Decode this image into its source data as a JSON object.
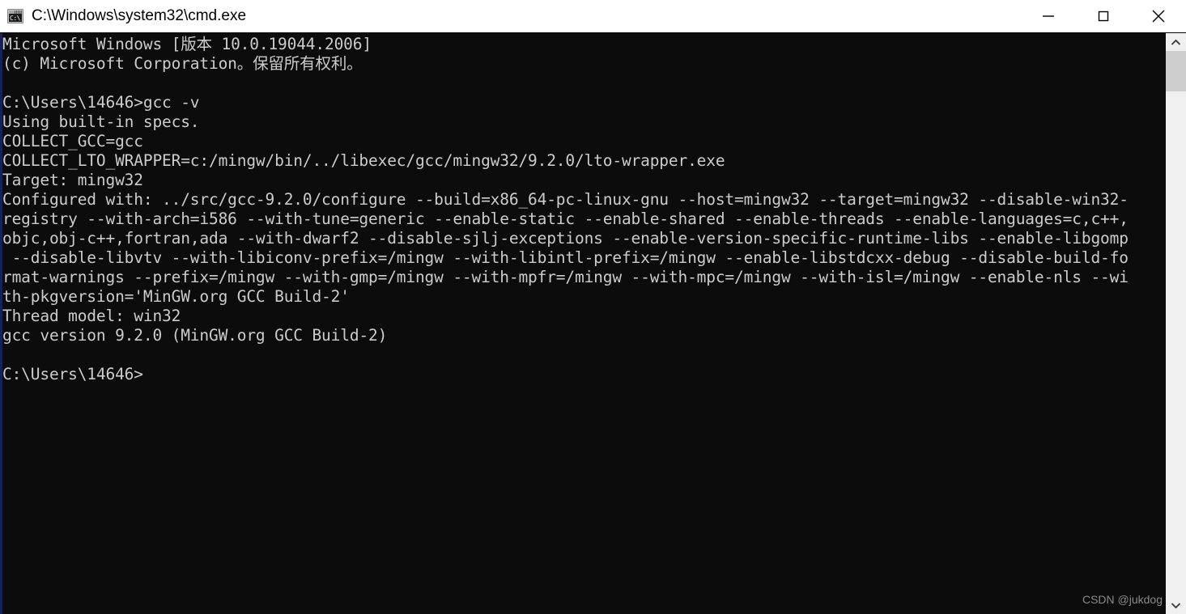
{
  "window": {
    "title": "C:\\Windows\\system32\\cmd.exe",
    "icon_name": "cmd-console-icon",
    "icon_glyph": "C:\\.",
    "background_color": "#0c0c0c",
    "text_color": "#cccccc",
    "border_color": "#15205c"
  },
  "titlebar": {
    "minimize_label": "Minimize",
    "maximize_label": "Maximize",
    "close_label": "Close"
  },
  "scrollbar": {
    "up_arrow_label": "Scroll up",
    "down_arrow_label": "Scroll down",
    "thumb_label": "Scroll thumb",
    "track_color": "#f0f0f0",
    "thumb_color": "#cdcdcd"
  },
  "console": {
    "lines": [
      "Microsoft Windows [版本 10.0.19044.2006]",
      "(c) Microsoft Corporation。保留所有权利。",
      "",
      "C:\\Users\\14646>gcc -v",
      "Using built-in specs.",
      "COLLECT_GCC=gcc",
      "COLLECT_LTO_WRAPPER=c:/mingw/bin/../libexec/gcc/mingw32/9.2.0/lto-wrapper.exe",
      "Target: mingw32",
      "Configured with: ../src/gcc-9.2.0/configure --build=x86_64-pc-linux-gnu --host=mingw32 --target=mingw32 --disable-win32-",
      "registry --with-arch=i586 --with-tune=generic --enable-static --enable-shared --enable-threads --enable-languages=c,c++,",
      "objc,obj-c++,fortran,ada --with-dwarf2 --disable-sjlj-exceptions --enable-version-specific-runtime-libs --enable-libgomp",
      " --disable-libvtv --with-libiconv-prefix=/mingw --with-libintl-prefix=/mingw --enable-libstdcxx-debug --disable-build-fo",
      "rmat-warnings --prefix=/mingw --with-gmp=/mingw --with-mpfr=/mingw --with-mpc=/mingw --with-isl=/mingw --enable-nls --wi",
      "th-pkgversion='MinGW.org GCC Build-2'",
      "Thread model: win32",
      "gcc version 9.2.0 (MinGW.org GCC Build-2)",
      "",
      "C:\\Users\\14646>"
    ],
    "command_entered": "gcc -v",
    "prompt": "C:\\Users\\14646>",
    "gcc_version": "9.2.0",
    "gcc_target": "mingw32",
    "gcc_thread_model": "win32",
    "gcc_pkgversion": "MinGW.org GCC Build-2",
    "windows_version": "10.0.19044.2006"
  },
  "watermark": {
    "text": "CSDN @jukdog"
  }
}
